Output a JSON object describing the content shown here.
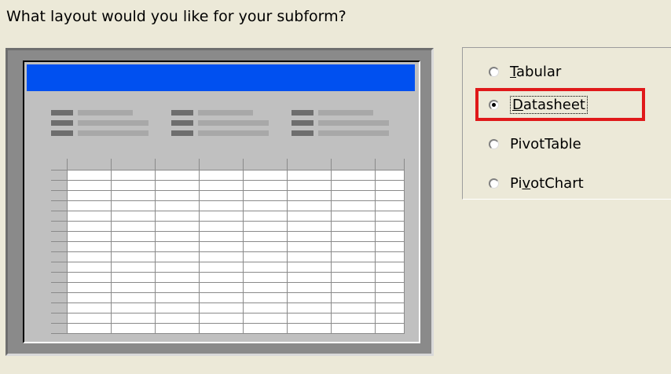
{
  "dialog": {
    "question": "What layout would you like for your subform?"
  },
  "options": [
    {
      "label": "Tabular",
      "mnemonic_index": 0,
      "checked": false
    },
    {
      "label": "Datasheet",
      "mnemonic_index": 0,
      "checked": true
    },
    {
      "label": "PivotTable",
      "mnemonic_index": -1,
      "checked": false
    },
    {
      "label": "PivotChart",
      "mnemonic_index": 2,
      "checked": false
    }
  ],
  "colors": {
    "dialog_background": "#ece9d8",
    "preview_title_bar": "#0050f0",
    "highlight_box": "#e0191a"
  }
}
